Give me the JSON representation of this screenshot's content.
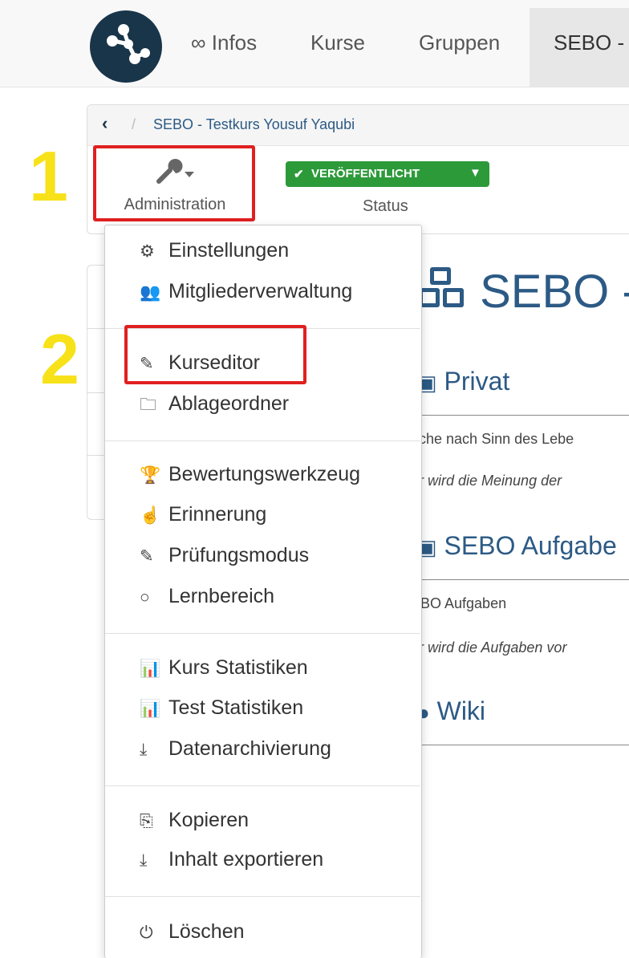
{
  "topnav": {
    "infos": "∞ Infos",
    "kurse": "Kurse",
    "gruppen": "Gruppen",
    "active": "SEBO -"
  },
  "breadcrumb": {
    "back": "‹",
    "separator": "/",
    "course": "SEBO - Testkurs Yousuf Yaqubi"
  },
  "toolbar": {
    "admin_label": "Administration",
    "status_badge": "VERÖFFENTLICHT",
    "status_label": "Status"
  },
  "markers": {
    "one": "1",
    "two": "2"
  },
  "content": {
    "title": "SEBO -",
    "privat": "Privat",
    "privat_text": "uche nach Sinn des Lebe",
    "privat_italic": "er wird die Meinung der",
    "aufgaben": "SEBO Aufgabe",
    "aufgaben_text": "EBO Aufgaben",
    "aufgaben_italic": "er wird die Aufgaben vor",
    "wiki": "Wiki"
  },
  "menu": {
    "einstellungen": "Einstellungen",
    "mitglieder": "Mitgliederverwaltung",
    "kurseditor": "Kurseditor",
    "ablage": "Ablageordner",
    "bewertung": "Bewertungswerkzeug",
    "erinnerung": "Erinnerung",
    "pruefung": "Prüfungsmodus",
    "lernbereich": "Lernbereich",
    "kursstat": "Kurs Statistiken",
    "teststat": "Test Statistiken",
    "archiv": "Datenarchivierung",
    "kopieren": "Kopieren",
    "export": "Inhalt exportieren",
    "loeschen": "Löschen"
  },
  "icons": {
    "logo": "network-logo-icon",
    "admin": "wrench-icon",
    "status": "check-icon"
  },
  "colors": {
    "brand_dark": "#19354a",
    "link": "#2c5a85",
    "status_green": "#2d9a3a",
    "highlight_red": "#e02020",
    "marker_yellow": "#f7e21a"
  }
}
